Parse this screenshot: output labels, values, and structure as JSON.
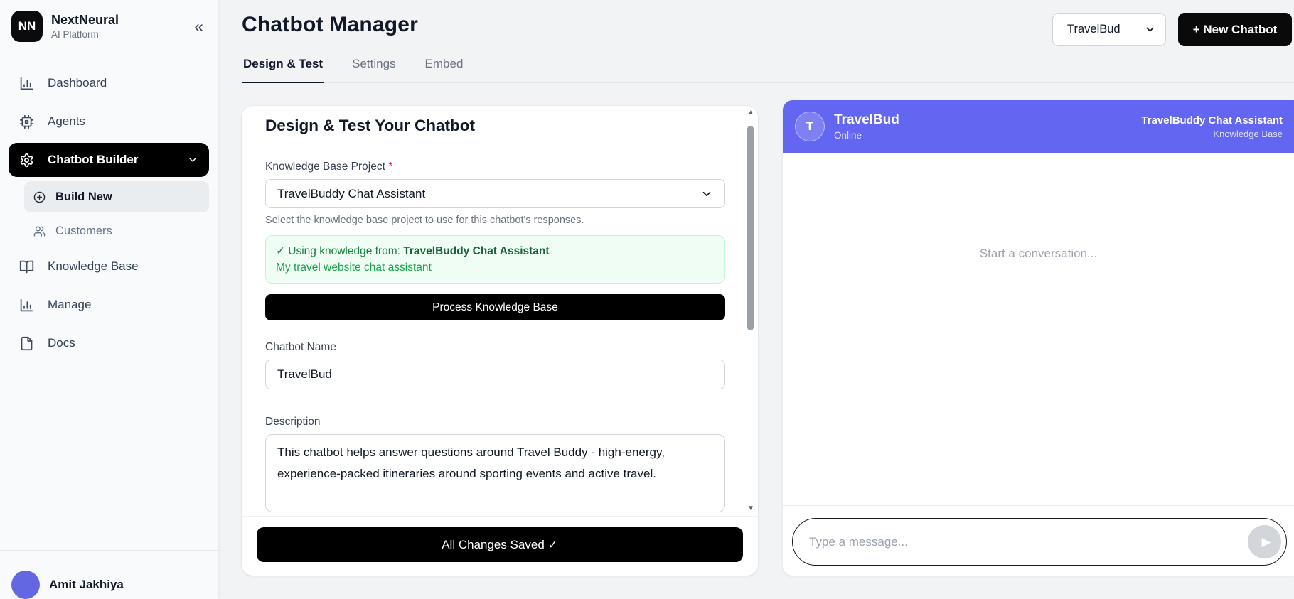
{
  "brand": {
    "initials": "NN",
    "name": "NextNeural",
    "subtitle": "AI Platform"
  },
  "icons": {
    "collapse": "«",
    "scroll_up": "▲",
    "scroll_down": "▼",
    "send": "▶"
  },
  "sidebar": {
    "items": [
      {
        "label": "Dashboard",
        "icon": "bar-chart-icon"
      },
      {
        "label": "Agents",
        "icon": "cpu-icon"
      },
      {
        "label": "Chatbot Builder",
        "icon": "gear-icon",
        "active": true
      },
      {
        "label": "Build New",
        "icon": "plus-circle-icon",
        "active": true
      },
      {
        "label": "Customers",
        "icon": "users-icon"
      },
      {
        "label": "Knowledge Base",
        "icon": "book-open-icon"
      },
      {
        "label": "Manage",
        "icon": "bar-chart-icon"
      },
      {
        "label": "Docs",
        "icon": "file-icon"
      }
    ],
    "user": {
      "name": "Amit Jakhiya"
    }
  },
  "header": {
    "title": "Chatbot Manager",
    "tabs": [
      {
        "label": "Design & Test",
        "active": true
      },
      {
        "label": "Settings"
      },
      {
        "label": "Embed"
      }
    ],
    "chatbot_selector_value": "TravelBud",
    "new_chatbot_label": "+ New Chatbot"
  },
  "builder": {
    "heading": "Design & Test Your Chatbot",
    "kb_label": "Knowledge Base Project",
    "required_mark": "*",
    "kb_select_value": "TravelBuddy Chat Assistant",
    "kb_help": "Select the knowledge base project to use for this chatbot's responses.",
    "kb_status_prefix": "✓ Using knowledge from: ",
    "kb_status_project": "TravelBuddy Chat Assistant",
    "kb_status_description": "My travel website chat assistant",
    "process_button_label": "Process Knowledge Base",
    "name_label": "Chatbot Name",
    "name_value": "TravelBud",
    "description_label": "Description",
    "description_value": "This chatbot helps answer questions around Travel Buddy - high-energy, experience-packed itineraries around sporting events and active travel.",
    "save_button_label": "All Changes Saved ✓"
  },
  "chat": {
    "bot_name": "TravelBud",
    "avatar_initial": "T",
    "status": "Online",
    "kb_name": "TravelBuddy Chat Assistant",
    "kb_tag": "Knowledge Base",
    "empty_state": "Start a conversation...",
    "input_placeholder": "Type a message..."
  },
  "colors": {
    "accent": "#6366f1",
    "primary_button": "#000000",
    "success_bg": "#f0fdf4",
    "success_border": "#bbf7d0",
    "success_text": "#15803d",
    "sidebar_bg": "#f8fafc",
    "main_bg": "#f2f3f5"
  }
}
